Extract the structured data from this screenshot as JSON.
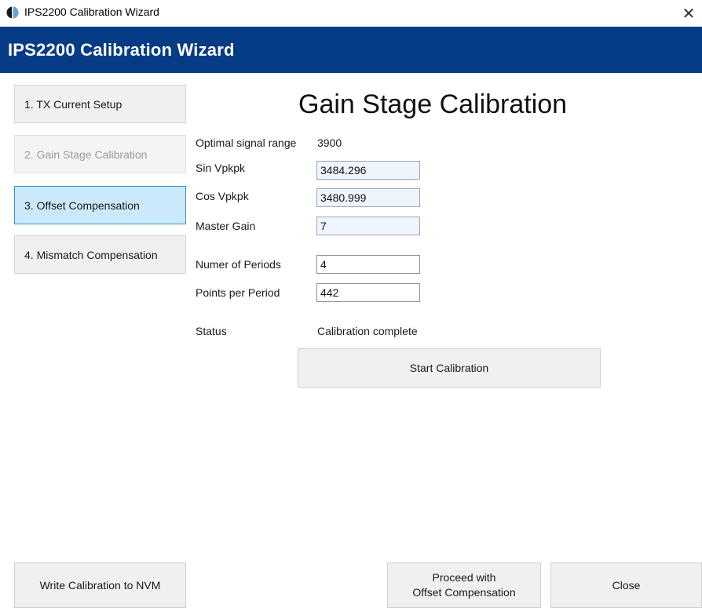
{
  "window": {
    "title": "IPS2200 Calibration Wizard",
    "close_glyph": "✕",
    "banner_title": "IPS2200 Calibration Wizard",
    "banner_color": "#063b86"
  },
  "nav": {
    "items": [
      {
        "label": "1. TX Current Setup",
        "state": "normal"
      },
      {
        "label": "2. Gain Stage Calibration",
        "state": "disabled"
      },
      {
        "label": "3. Offset Compensation",
        "state": "active"
      },
      {
        "label": "4. Mismatch Compensation",
        "state": "normal"
      }
    ]
  },
  "main": {
    "heading": "Gain Stage Calibration",
    "optimal_signal_range": {
      "label": "Optimal signal range",
      "value": "3900"
    },
    "sin_vpkpk": {
      "label": "Sin Vpkpk",
      "value": "3484.296"
    },
    "cos_vpkpk": {
      "label": "Cos Vpkpk",
      "value": "3480.999"
    },
    "master_gain": {
      "label": "Master Gain",
      "value": "7"
    },
    "num_periods": {
      "label": "Numer of Periods",
      "value": "4"
    },
    "points_per_period": {
      "label": "Points per Period",
      "value": "442"
    },
    "status": {
      "label": "Status",
      "value": "Calibration complete"
    },
    "start_button": "Start Calibration"
  },
  "footer": {
    "write_nvm_button": "Write Calibration to NVM",
    "proceed_button_line1": "Proceed with",
    "proceed_button_line2": "Offset Compensation",
    "close_button": "Close"
  }
}
